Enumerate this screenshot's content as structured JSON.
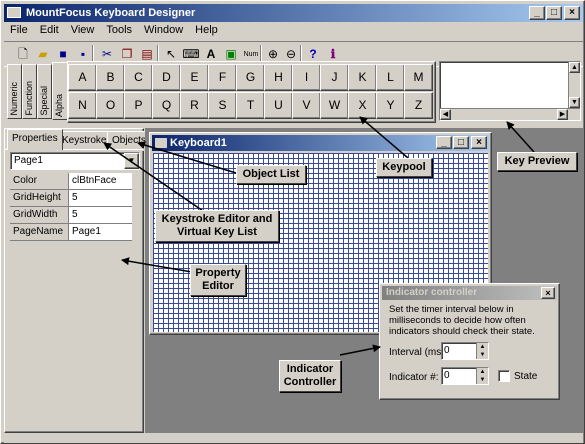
{
  "window": {
    "title": "MountFocus Keyboard Designer",
    "minimize": "_",
    "maximize": "□",
    "close": "×"
  },
  "menu": [
    "File",
    "Edit",
    "View",
    "Tools",
    "Window",
    "Help"
  ],
  "toolbar": {
    "text_tool": "A",
    "num_tool": "Num",
    "help": "?"
  },
  "keypool": {
    "tabs": [
      "Numeric",
      "Function",
      "Special",
      "Alpha"
    ],
    "keys": [
      "A",
      "B",
      "C",
      "D",
      "E",
      "F",
      "G",
      "H",
      "I",
      "J",
      "K",
      "L",
      "M",
      "N",
      "O",
      "P",
      "Q",
      "R",
      "S",
      "T",
      "U",
      "V",
      "W",
      "X",
      "Y",
      "Z"
    ]
  },
  "left_panel": {
    "tabs": [
      "Properties",
      "Keystrokes",
      "Objects"
    ],
    "page_select": "Page1",
    "properties": [
      {
        "name": "Color",
        "value": "clBtnFace"
      },
      {
        "name": "GridHeight",
        "value": "5"
      },
      {
        "name": "GridWidth",
        "value": "5"
      },
      {
        "name": "PageName",
        "value": "Page1"
      }
    ]
  },
  "keyboard_window": {
    "title": "Keyboard1"
  },
  "indicator": {
    "title": "Indicator controller",
    "description": "Set the timer interval below in milliseconds to decide how often indicators should check their state.",
    "interval_label": "Interval (ms):",
    "interval_value": "0",
    "indicator_label": "Indicator #:",
    "indicator_value": "0",
    "state_label": "State"
  },
  "callouts": {
    "object_list": "Object List",
    "keypool": "Keypool",
    "key_preview": "Key Preview",
    "keystroke_editor": "Keystroke Editor and Virtual Key List",
    "property_editor": "Property Editor",
    "indicator_controller": "Indicator Controller"
  },
  "colors": {
    "titlebar": "#0a246a",
    "face": "#d4d0c8",
    "grid": "#3a4a9a"
  }
}
